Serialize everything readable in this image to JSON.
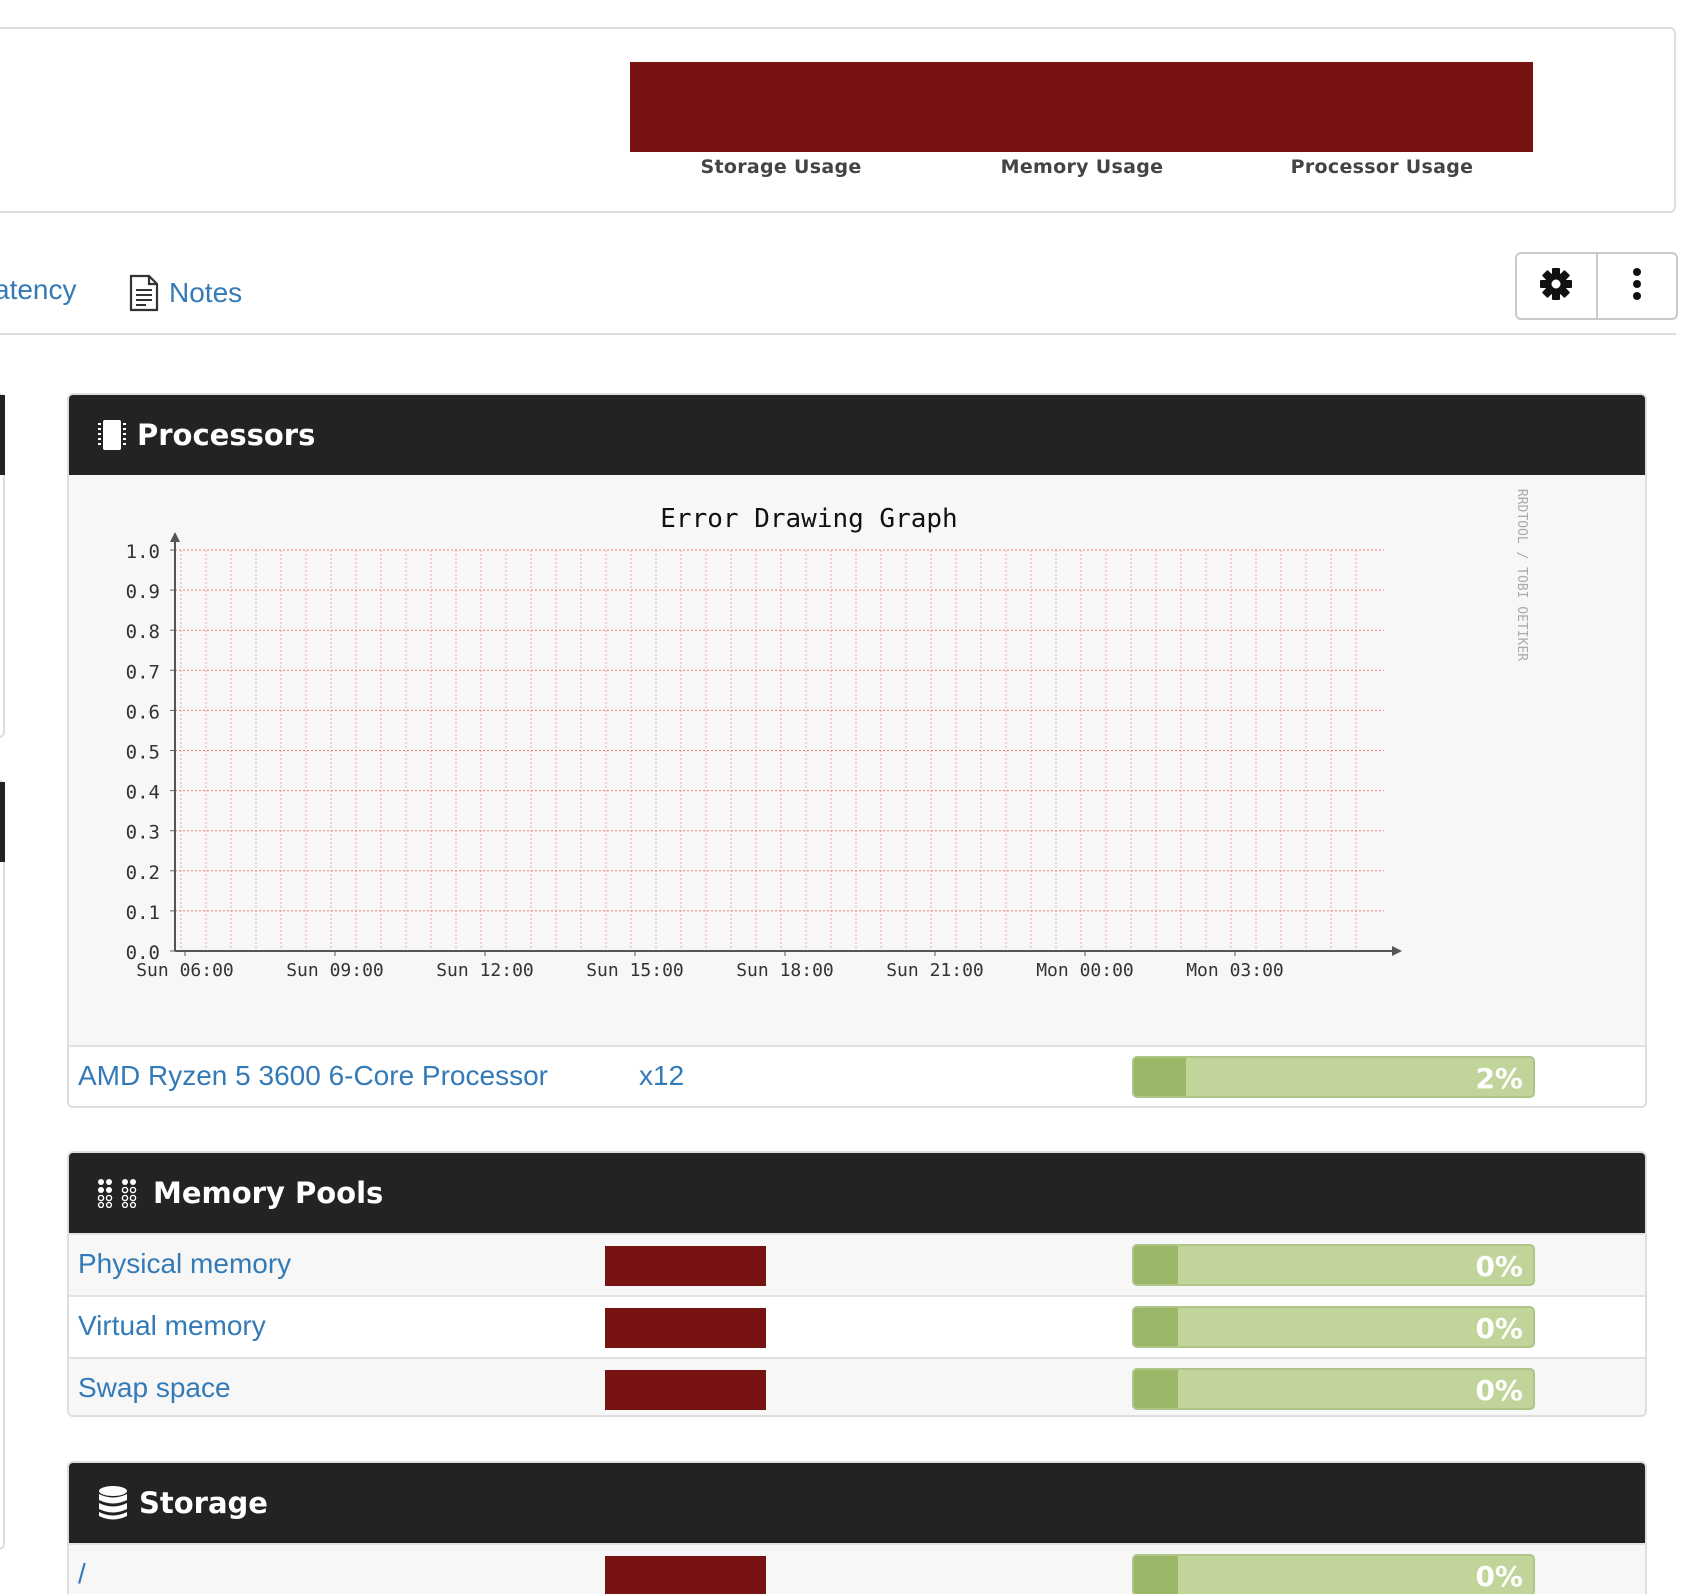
{
  "overview": {
    "tiles": [
      {
        "label": "Storage Usage"
      },
      {
        "label": "Memory Usage"
      },
      {
        "label": "Processor Usage"
      }
    ]
  },
  "tabs": {
    "latency": "atency",
    "notes": "Notes"
  },
  "processors": {
    "title": "Processors",
    "cpu_name": "AMD Ryzen 5 3600 6-Core Processor",
    "cpu_count": "x12",
    "percent_label": "2%",
    "percent_value": 2
  },
  "chart_data": {
    "type": "line",
    "title": "Error Drawing Graph",
    "watermark": "RRDTOOL / TOBI OETIKER",
    "y_ticks": [
      "1.0",
      "0.9",
      "0.8",
      "0.7",
      "0.6",
      "0.5",
      "0.4",
      "0.3",
      "0.2",
      "0.1",
      "0.0"
    ],
    "x_ticks": [
      "Sun 06:00",
      "Sun 09:00",
      "Sun 12:00",
      "Sun 15:00",
      "Sun 18:00",
      "Sun 21:00",
      "Mon 00:00",
      "Mon 03:00"
    ],
    "ylim": [
      0,
      1
    ],
    "grid": true,
    "series": []
  },
  "memory": {
    "title": "Memory Pools",
    "items": [
      {
        "name": "Physical memory",
        "percent_label": "0%",
        "percent_value": 0
      },
      {
        "name": "Virtual memory",
        "percent_label": "0%",
        "percent_value": 0
      },
      {
        "name": "Swap space",
        "percent_label": "0%",
        "percent_value": 0
      }
    ]
  },
  "storage": {
    "title": "Storage",
    "items": [
      {
        "name": "/",
        "percent_label": "0%",
        "percent_value": 0
      }
    ]
  },
  "colors": {
    "usage_tile": "#771311",
    "bar_bg": "#c1d49a",
    "bar_fill": "#9ab767",
    "link": "#337ab7",
    "panel_header": "#232323"
  }
}
